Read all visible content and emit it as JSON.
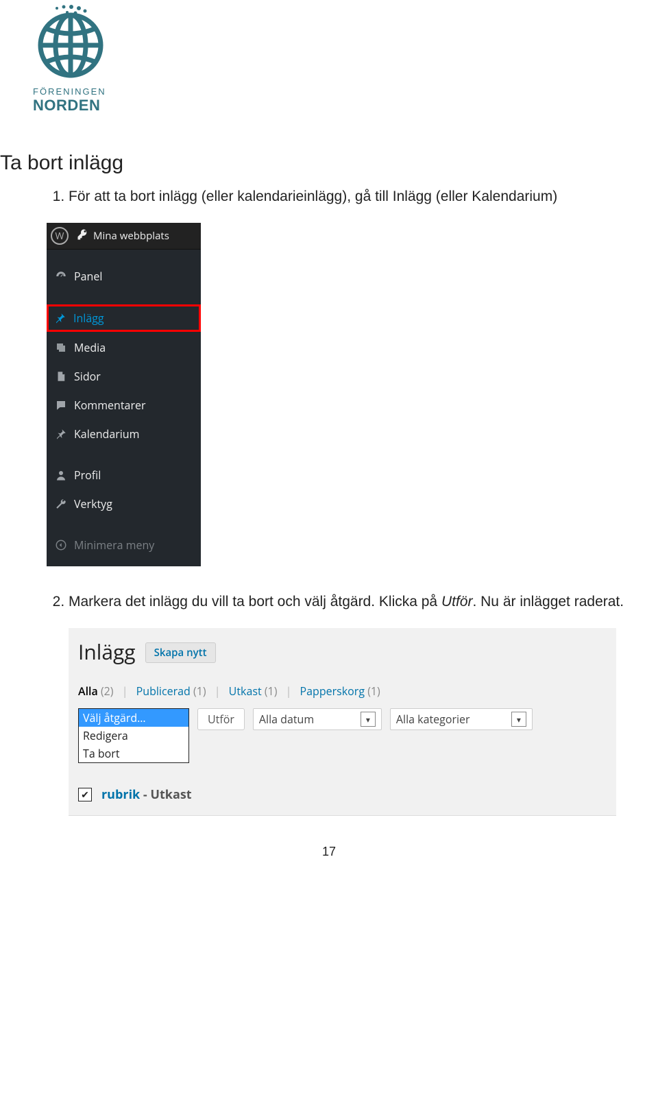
{
  "logo": {
    "line1": "FÖRENINGEN",
    "line2": "NORDEN"
  },
  "heading": "Ta bort inlägg",
  "step1": "För att ta bort inlägg (eller kalendarieinlägg), gå till Inlägg (eller Kalendarium)",
  "wp": {
    "topbar": "Mina webbplats",
    "panel": "Panel",
    "inlagg": "Inlägg",
    "media": "Media",
    "sidor": "Sidor",
    "kommentarer": "Kommentarer",
    "kalendarium": "Kalendarium",
    "profil": "Profil",
    "verktyg": "Verktyg",
    "minimera": "Minimera meny"
  },
  "step2_a": "Markera det inlägg du vill ta bort och välj åtgärd. Klicka på ",
  "step2_em": "Utför",
  "step2_b": ". Nu är inlägget raderat.",
  "posts": {
    "title": "Inlägg",
    "new_btn": "Skapa nytt",
    "tabs": {
      "alla": "Alla",
      "alla_n": "(2)",
      "pub": "Publicerad",
      "pub_n": "(1)",
      "utk": "Utkast",
      "utk_n": "(1)",
      "pap": "Papperskorg",
      "pap_n": "(1)"
    },
    "actions": {
      "valj": "Välj åtgärd…",
      "redigera": "Redigera",
      "tabort": "Ta bort"
    },
    "utfor": "Utför",
    "datum": "Alla datum",
    "kategori": "Alla kategorier",
    "row": {
      "name": "rubrik",
      "dash": " - ",
      "status": "Utkast"
    }
  },
  "page_number": "17"
}
